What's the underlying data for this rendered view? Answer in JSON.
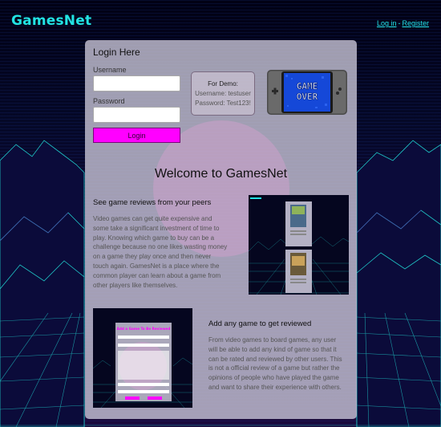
{
  "header": {
    "brand": "GamesNet",
    "login_link": "Log in",
    "separator": "-",
    "register_link": "Register"
  },
  "login": {
    "title": "Login Here",
    "username_label": "Username",
    "username_value": "",
    "password_label": "Password",
    "password_value": "",
    "button_label": "Login"
  },
  "demo": {
    "title": "For Demo:",
    "username_line": "Username: testuser",
    "password_line": "Password: Test123!"
  },
  "console_screen": {
    "line1": "GAME",
    "line2": "OVER"
  },
  "welcome": {
    "title": "Welcome to GamesNet"
  },
  "section1": {
    "heading": "See game reviews from your peers",
    "lines": [
      "Video games can get quite expensive and",
      "some take a significant investment of time to",
      "play. Knowing which game to buy can be a",
      "challenge because no one likes wasting money",
      "on a game they play once and then never",
      "touch again. GamesNet is a place where the",
      "common player can learn about a game from",
      "other players like themselves."
    ]
  },
  "section2": {
    "heading": "Add any game to get reviewed",
    "lines": [
      "From video games to board games, any user",
      "will be able to add any kind of game so that it",
      "can be rated and reviewed by other users. This",
      "is not a official review of a game but rather the",
      "opinions of people who have played the game",
      "and want to share their experience with others."
    ],
    "screenshot_title": "Add a Game To Be Reviewed"
  },
  "colors": {
    "accent": "#22e3e3",
    "button": "#ff00ff",
    "panel": "#c8c4d6"
  }
}
